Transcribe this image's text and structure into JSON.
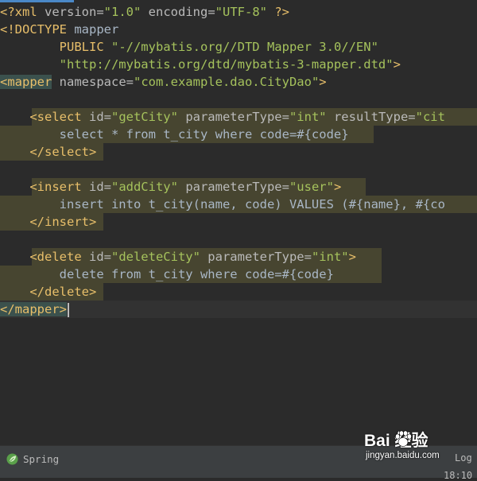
{
  "editor": {
    "lines": [
      {
        "tokens": [
          {
            "t": "<?xml",
            "c": "t-pi"
          },
          {
            "t": " version=",
            "c": "t-attr"
          },
          {
            "t": "\"1.0\"",
            "c": "t-val"
          },
          {
            "t": " encoding=",
            "c": "t-attr"
          },
          {
            "t": "\"UTF-8\"",
            "c": "t-val"
          },
          {
            "t": " ?>",
            "c": "t-pi"
          }
        ]
      },
      {
        "tokens": [
          {
            "t": "<!DOCTYPE",
            "c": "t-tag"
          },
          {
            "t": " mapper",
            "c": "t-dt"
          }
        ]
      },
      {
        "tokens": [
          {
            "t": "        PUBLIC ",
            "c": "t-tag"
          },
          {
            "t": "\"-//mybatis.org//DTD Mapper 3.0//EN\"",
            "c": "t-dtv"
          }
        ]
      },
      {
        "tokens": [
          {
            "t": "        ",
            "c": "t-dt"
          },
          {
            "t": "\"http://mybatis.org/dtd/mybatis-3-mapper.dtd\"",
            "c": "t-dtv"
          },
          {
            "t": ">",
            "c": "t-tag"
          }
        ]
      },
      {
        "tokens": [
          {
            "t": "<mapper",
            "c": "t-tag t-root"
          },
          {
            "t": " namespace=",
            "c": "t-attr"
          },
          {
            "t": "\"com.example.dao.CityDao\"",
            "c": "t-val"
          },
          {
            "t": ">",
            "c": "t-tag"
          }
        ]
      },
      {
        "tokens": []
      },
      {
        "hl": [
          40,
          600
        ],
        "tokens": [
          {
            "t": "    <select",
            "c": "t-tag"
          },
          {
            "t": " id=",
            "c": "t-attr"
          },
          {
            "t": "\"getCity\"",
            "c": "t-val"
          },
          {
            "t": " parameterType=",
            "c": "t-attr"
          },
          {
            "t": "\"int\"",
            "c": "t-val"
          },
          {
            "t": " resultType=",
            "c": "t-attr"
          },
          {
            "t": "\"cit",
            "c": "t-val"
          }
        ]
      },
      {
        "hl": [
          0,
          470
        ],
        "tokens": [
          {
            "t": "        select * from t_city where code=#{code}",
            "c": "t-sql"
          }
        ]
      },
      {
        "hl": [
          0,
          130
        ],
        "tokens": [
          {
            "t": "    </select>",
            "c": "t-tag"
          }
        ]
      },
      {
        "tokens": []
      },
      {
        "hl": [
          40,
          460
        ],
        "tokens": [
          {
            "t": "    <insert",
            "c": "t-tag"
          },
          {
            "t": " id=",
            "c": "t-attr"
          },
          {
            "t": "\"addCity\"",
            "c": "t-val"
          },
          {
            "t": " parameterType=",
            "c": "t-attr"
          },
          {
            "t": "\"user\"",
            "c": "t-val"
          },
          {
            "t": ">",
            "c": "t-tag"
          }
        ]
      },
      {
        "hl": [
          0,
          600
        ],
        "tokens": [
          {
            "t": "        insert into t_city(name, code) VALUES (#{name}, #{co",
            "c": "t-sql"
          }
        ]
      },
      {
        "hl": [
          0,
          130
        ],
        "tokens": [
          {
            "t": "    </insert>",
            "c": "t-tag"
          }
        ]
      },
      {
        "tokens": []
      },
      {
        "hl": [
          40,
          480
        ],
        "tokens": [
          {
            "t": "    <delete",
            "c": "t-tag"
          },
          {
            "t": " id=",
            "c": "t-attr"
          },
          {
            "t": "\"deleteCity\"",
            "c": "t-val"
          },
          {
            "t": " parameterType=",
            "c": "t-attr"
          },
          {
            "t": "\"int\"",
            "c": "t-val"
          },
          {
            "t": ">",
            "c": "t-tag"
          }
        ]
      },
      {
        "hl": [
          0,
          480
        ],
        "tokens": [
          {
            "t": "        delete from t_city where code=#{code}",
            "c": "t-sql"
          }
        ]
      },
      {
        "hl": [
          0,
          130
        ],
        "tokens": [
          {
            "t": "    </delete>",
            "c": "t-tag"
          }
        ]
      },
      {
        "cursor": true,
        "tokens": [
          {
            "t": "</mapper>",
            "c": "t-tag t-root"
          }
        ]
      }
    ]
  },
  "statusbar": {
    "spring_label": "Spring",
    "spring_icon": "leaf-icon",
    "log_label": "Log",
    "time": "18:10"
  },
  "watermark": {
    "logo_text": "Bai  经验",
    "url": "jingyan.baidu.com"
  },
  "colors": {
    "background": "#2b2b2b",
    "tag": "#e8bf6a",
    "attribute": "#bababa",
    "value": "#a5c25c",
    "highlight": "#474530"
  }
}
